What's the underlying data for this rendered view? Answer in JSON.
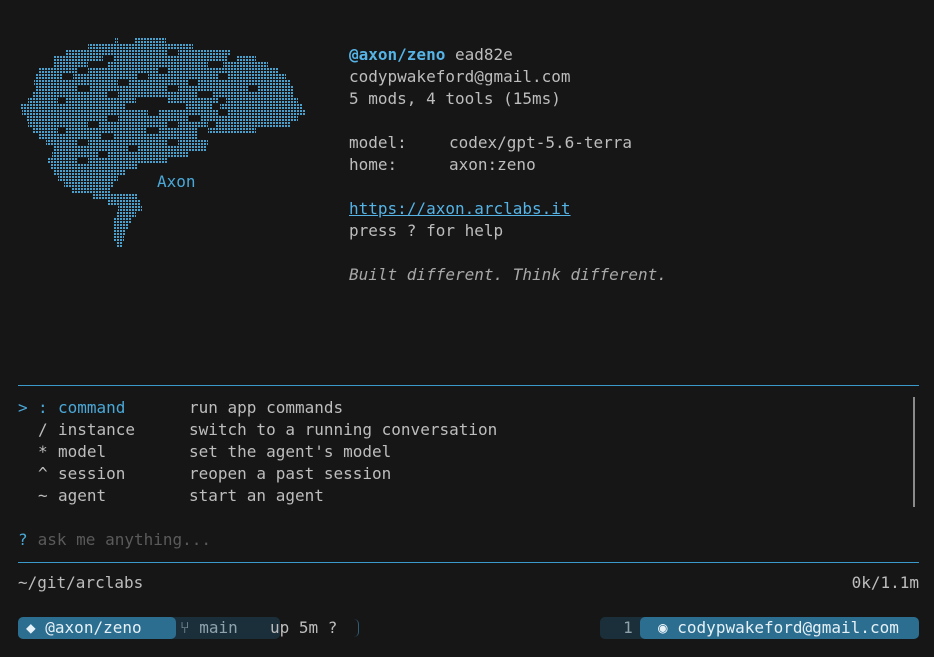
{
  "logo": {
    "label": "Axon"
  },
  "info": {
    "handle": "@axon/zeno",
    "commit": "ead82e",
    "email": "codypwakeford@gmail.com",
    "summary": "5 mods, 4 tools (15ms)",
    "model_key": "model:",
    "model_value": "codex/gpt-5.6-terra",
    "home_key": "home:",
    "home_value": "axon:zeno",
    "url": "https://axon.arclabs.it",
    "help": "press ? for help",
    "tagline": "Built different. Think different."
  },
  "menu": {
    "pointer": ">",
    "items": [
      {
        "symbol": ":",
        "name": "command",
        "desc": "run app commands"
      },
      {
        "symbol": "/",
        "name": "instance",
        "desc": "switch to a running conversation"
      },
      {
        "symbol": "*",
        "name": "model",
        "desc": "set the agent's model"
      },
      {
        "symbol": "^",
        "name": "session",
        "desc": "reopen a past session"
      },
      {
        "symbol": "~",
        "name": "agent",
        "desc": "start an agent"
      }
    ]
  },
  "prompt": {
    "marker": "?",
    "placeholder": "ask me anything...",
    "value": ""
  },
  "footer": {
    "path": "~/git/arclabs",
    "usage": "0k/1.1m"
  },
  "statusbar": {
    "agent_icon": "◆",
    "agent": "@axon/zeno",
    "branch_icon": "⑂",
    "branch": "main",
    "uptime": "up 5m ?",
    "count": "1",
    "user_icon": "◉",
    "user": "codypwakeford@gmail.com"
  },
  "colors": {
    "accent": "#4aa8d8",
    "background": "#161616",
    "text": "#bdbdbd",
    "pill": "#2c6e90",
    "pill_dark": "#1b2f3b"
  }
}
